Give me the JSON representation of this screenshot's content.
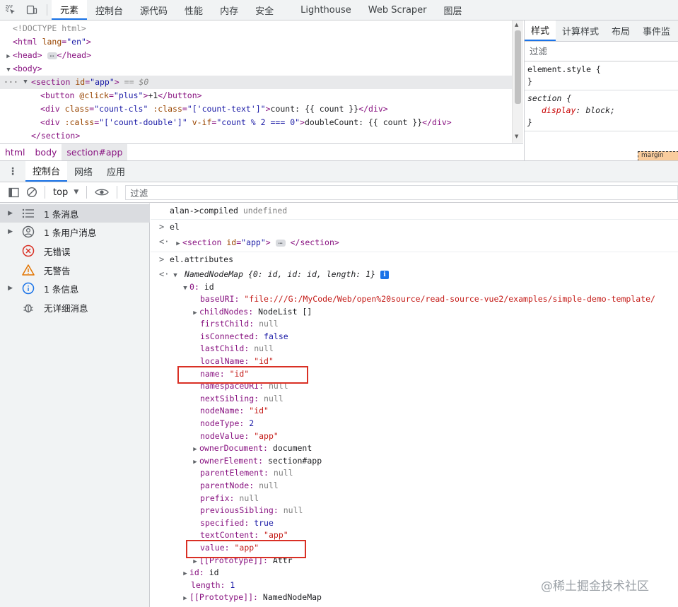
{
  "top_tabs": [
    {
      "label": "元素",
      "active": true
    },
    {
      "label": "控制台",
      "active": false
    },
    {
      "label": "源代码",
      "active": false
    },
    {
      "label": "性能",
      "active": false
    },
    {
      "label": "内存",
      "active": false
    },
    {
      "label": "安全",
      "active": false
    },
    {
      "label": "Lighthouse",
      "active": false
    },
    {
      "label": "Web Scraper",
      "active": false
    },
    {
      "label": "图层",
      "active": false
    }
  ],
  "elements": {
    "doctype": "<!DOCTYPE html>",
    "html_open": "html",
    "lang_attr": "lang",
    "lang_val": "\"en\"",
    "head": "head",
    "body": "body",
    "section": "section",
    "id_attr": "id",
    "id_val": "\"app\"",
    "eq_marker": "== $0",
    "button": "button",
    "btn_attr": "@click",
    "btn_val": "\"plus\"",
    "btn_text": "+1",
    "div": "div",
    "div1_class_attr": "class",
    "div1_class_val": "\"count-cls\"",
    "div1_bind_attr": ":class",
    "div1_bind_val": "\"['count-text']\"",
    "div1_text": "count: {{ count }}",
    "div2_attr": ":calss",
    "div2_val": "\"['count-double']\"",
    "div2_if_attr": "v-if",
    "div2_if_val": "\"count % 2 === 0\"",
    "div2_text": "doubleCount: {{ count }}"
  },
  "breadcrumb": [
    {
      "label": "html",
      "selected": false
    },
    {
      "label": "body",
      "selected": false
    },
    {
      "label": "section#app",
      "selected": true
    }
  ],
  "styles": {
    "tabs": [
      {
        "label": "样式",
        "active": true
      },
      {
        "label": "计算样式",
        "active": false
      },
      {
        "label": "布局",
        "active": false
      },
      {
        "label": "事件监",
        "active": false
      }
    ],
    "filter_placeholder": "过滤",
    "element_style": "element.style {",
    "close_brace": "}",
    "rule_selector": "section {",
    "rule_prop": "display",
    "rule_val": "block;",
    "box_label": "margin"
  },
  "drawer_tabs": [
    {
      "label": "控制台",
      "active": true
    },
    {
      "label": "网络",
      "active": false
    },
    {
      "label": "应用",
      "active": false
    }
  ],
  "console_toolbar": {
    "context": "top",
    "filter_placeholder": "过滤"
  },
  "sidebar": [
    {
      "label": "1 条消息",
      "icon": "list-icon",
      "expandable": true,
      "selected": true
    },
    {
      "label": "1 条用户消息",
      "icon": "user-icon",
      "expandable": true,
      "selected": false
    },
    {
      "label": "无错误",
      "icon": "error-icon",
      "expandable": false,
      "selected": false
    },
    {
      "label": "无警告",
      "icon": "warning-icon",
      "expandable": false,
      "selected": false
    },
    {
      "label": "1 条信息",
      "icon": "info-icon",
      "expandable": true,
      "selected": false
    },
    {
      "label": "无详细消息",
      "icon": "bug-icon",
      "expandable": false,
      "selected": false
    }
  ],
  "console": {
    "line0_text": "alan->compiled",
    "line0_val": "undefined",
    "cmd1": "el",
    "res1_tag": "section",
    "res1_attr": "id",
    "res1_val": "\"app\"",
    "cmd2": "el.attributes",
    "nnm_summary": "NamedNodeMap {0: id, id: id, length: 1}",
    "item0_key": "0",
    "item0_val": "id",
    "props": [
      {
        "key": "baseURI",
        "value": "\"file:///G:/MyCode/Web/open%20source/read-source-vue2/examples/simple-demo-template/",
        "kind": "str",
        "expandable": false
      },
      {
        "key": "childNodes",
        "value": "NodeList []",
        "kind": "obj",
        "expandable": true
      },
      {
        "key": "firstChild",
        "value": "null",
        "kind": "null",
        "expandable": false
      },
      {
        "key": "isConnected",
        "value": "false",
        "kind": "kw",
        "expandable": false
      },
      {
        "key": "lastChild",
        "value": "null",
        "kind": "null",
        "expandable": false
      },
      {
        "key": "localName",
        "value": "\"id\"",
        "kind": "str",
        "expandable": false
      },
      {
        "key": "name",
        "value": "\"id\"",
        "kind": "str",
        "expandable": false
      },
      {
        "key": "namespaceURI",
        "value": "null",
        "kind": "null",
        "expandable": false
      },
      {
        "key": "nextSibling",
        "value": "null",
        "kind": "null",
        "expandable": false
      },
      {
        "key": "nodeName",
        "value": "\"id\"",
        "kind": "str",
        "expandable": false
      },
      {
        "key": "nodeType",
        "value": "2",
        "kind": "kw",
        "expandable": false
      },
      {
        "key": "nodeValue",
        "value": "\"app\"",
        "kind": "str",
        "expandable": false
      },
      {
        "key": "ownerDocument",
        "value": "document",
        "kind": "obj",
        "expandable": true
      },
      {
        "key": "ownerElement",
        "value": "section#app",
        "kind": "obj",
        "expandable": true
      },
      {
        "key": "parentElement",
        "value": "null",
        "kind": "null",
        "expandable": false
      },
      {
        "key": "parentNode",
        "value": "null",
        "kind": "null",
        "expandable": false
      },
      {
        "key": "prefix",
        "value": "null",
        "kind": "null",
        "expandable": false
      },
      {
        "key": "previousSibling",
        "value": "null",
        "kind": "null",
        "expandable": false
      },
      {
        "key": "specified",
        "value": "true",
        "kind": "kw",
        "expandable": false
      },
      {
        "key": "textContent",
        "value": "\"app\"",
        "kind": "str",
        "expandable": false
      },
      {
        "key": "value",
        "value": "\"app\"",
        "kind": "str",
        "expandable": false
      },
      {
        "key": "[[Prototype]]",
        "value": "Attr",
        "kind": "obj",
        "expandable": true
      }
    ],
    "id_key": "id",
    "id_val": "id",
    "length_key": "length",
    "length_val": "1",
    "proto_key": "[[Prototype]]",
    "proto_val": "NamedNodeMap"
  },
  "watermark": "@稀土掘金技术社区",
  "colors": {
    "accent": "#1a73e8",
    "highlight_box": "#d93025",
    "tag": "#881280",
    "string": "#c41a16"
  }
}
